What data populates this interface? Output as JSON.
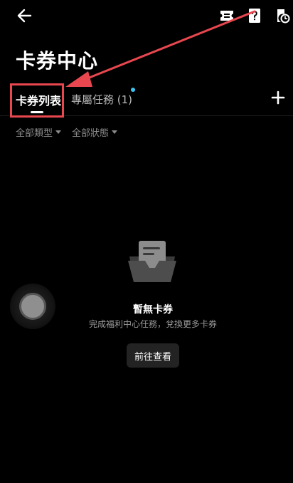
{
  "header": {
    "back_icon": "arrow-left-icon",
    "actions": [
      {
        "name": "ticket-icon"
      },
      {
        "name": "help-document-icon"
      },
      {
        "name": "history-icon"
      }
    ]
  },
  "page": {
    "title": "卡券中心"
  },
  "tabs": [
    {
      "label": "卡券列表",
      "active": true
    },
    {
      "label": "專屬任務 (1)",
      "active": false,
      "dot_color": "#3ec3f0"
    }
  ],
  "plus_icon": "plus-icon",
  "filters": [
    {
      "label": "全部類型"
    },
    {
      "label": "全部狀態"
    }
  ],
  "empty_state": {
    "illustration_icon": "empty-coupon-icon",
    "title": "暫無卡券",
    "subtitle": "完成福利中心任務，兌換更多卡券",
    "button_label": "前往查看"
  },
  "colors": {
    "background": "#000000",
    "highlight": "#e8474f",
    "accent_dot": "#3ec3f0"
  }
}
